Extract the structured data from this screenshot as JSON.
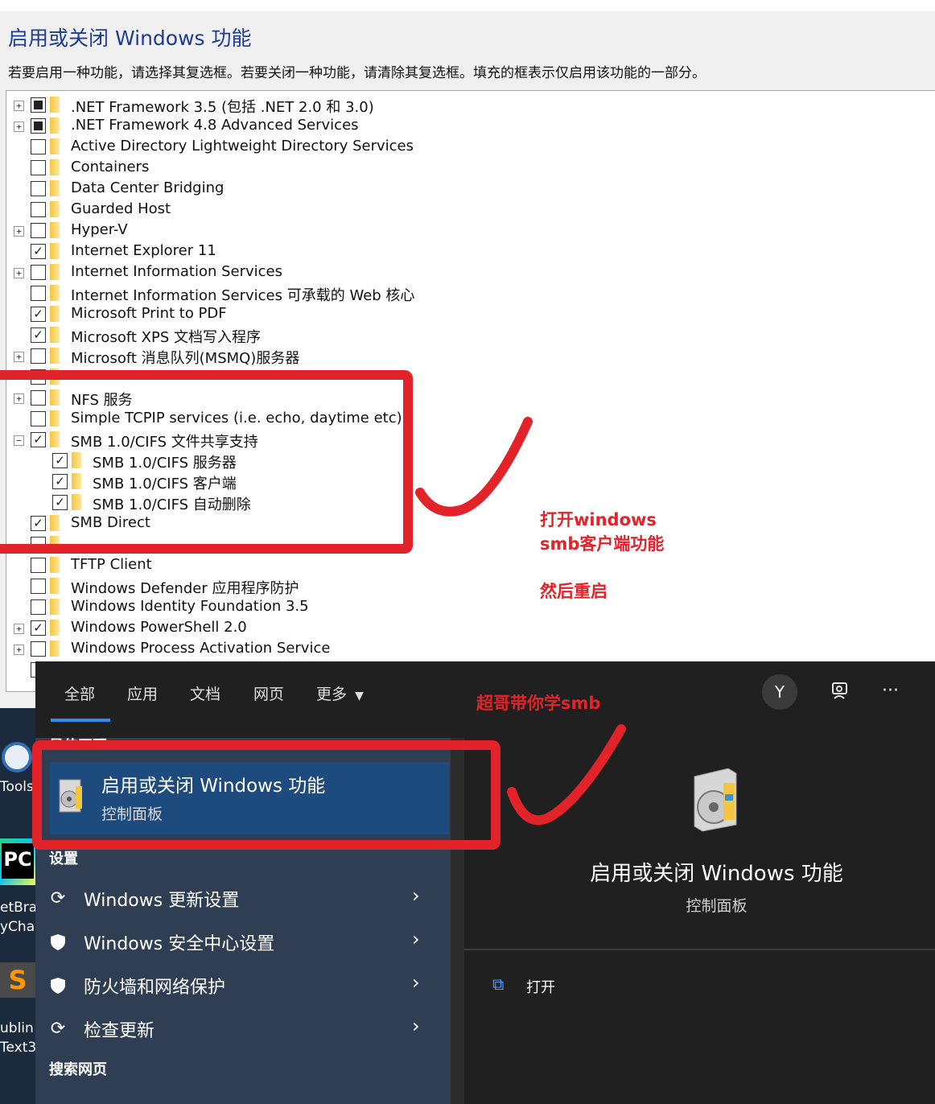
{
  "features_dialog": {
    "title": "启用或关闭 Windows 功能",
    "description": "若要启用一种功能，请选择其复选框。若要关闭一种功能，请清除其复选框。填充的框表示仅启用该功能的一部分。",
    "items": [
      {
        "label": ".NET Framework 3.5 (包括 .NET 2.0 和 3.0)",
        "state": "partial",
        "expander": "+",
        "indent": 0
      },
      {
        "label": ".NET Framework 4.8 Advanced Services",
        "state": "partial",
        "expander": "+",
        "indent": 0
      },
      {
        "label": "Active Directory Lightweight Directory Services",
        "state": "unchecked",
        "expander": "",
        "indent": 0
      },
      {
        "label": "Containers",
        "state": "unchecked",
        "expander": "",
        "indent": 0
      },
      {
        "label": "Data Center Bridging",
        "state": "unchecked",
        "expander": "",
        "indent": 0
      },
      {
        "label": "Guarded Host",
        "state": "unchecked",
        "expander": "",
        "indent": 0
      },
      {
        "label": "Hyper-V",
        "state": "unchecked",
        "expander": "+",
        "indent": 0
      },
      {
        "label": "Internet Explorer 11",
        "state": "checked",
        "expander": "",
        "indent": 0
      },
      {
        "label": "Internet Information Services",
        "state": "unchecked",
        "expander": "+",
        "indent": 0
      },
      {
        "label": "Internet Information Services 可承载的 Web 核心",
        "state": "unchecked",
        "expander": "",
        "indent": 0
      },
      {
        "label": "Microsoft Print to PDF",
        "state": "checked",
        "expander": "",
        "indent": 0
      },
      {
        "label": "Microsoft XPS 文档写入程序",
        "state": "checked",
        "expander": "",
        "indent": 0
      },
      {
        "label": "Microsoft 消息队列(MSMQ)服务器",
        "state": "unchecked",
        "expander": "+",
        "indent": 0
      },
      {
        "label": "",
        "state": "unchecked",
        "expander": "",
        "indent": 0
      },
      {
        "label": "NFS 服务",
        "state": "unchecked",
        "expander": "+",
        "indent": 0
      },
      {
        "label": "Simple TCPIP services (i.e. echo, daytime etc)",
        "state": "unchecked",
        "expander": "",
        "indent": 0
      },
      {
        "label": "SMB 1.0/CIFS 文件共享支持",
        "state": "checked",
        "expander": "−",
        "indent": 0
      },
      {
        "label": "SMB 1.0/CIFS 服务器",
        "state": "checked",
        "expander": "",
        "indent": 1
      },
      {
        "label": "SMB 1.0/CIFS 客户端",
        "state": "checked",
        "expander": "",
        "indent": 1
      },
      {
        "label": "SMB 1.0/CIFS 自动删除",
        "state": "checked",
        "expander": "",
        "indent": 1
      },
      {
        "label": "SMB Direct",
        "state": "checked",
        "expander": "",
        "indent": 0
      },
      {
        "label": "",
        "state": "unchecked",
        "expander": "",
        "indent": 0
      },
      {
        "label": "TFTP Client",
        "state": "unchecked",
        "expander": "",
        "indent": 0
      },
      {
        "label": "Windows Defender 应用程序防护",
        "state": "unchecked",
        "expander": "",
        "indent": 0
      },
      {
        "label": "Windows Identity Foundation 3.5",
        "state": "unchecked",
        "expander": "",
        "indent": 0
      },
      {
        "label": "Windows PowerShell 2.0",
        "state": "checked",
        "expander": "+",
        "indent": 0
      },
      {
        "label": "Windows Process Activation Service",
        "state": "unchecked",
        "expander": "+",
        "indent": 0
      },
      {
        "label": "",
        "state": "unchecked",
        "expander": "",
        "indent": 0
      }
    ]
  },
  "annotations": {
    "note_line1": "打开windows",
    "note_line2": "smb客户端功能",
    "note_line3": "然后重启",
    "search_note": "超哥带你学smb",
    "color": "#e3232a"
  },
  "desktop": {
    "icons": [
      {
        "label": "Tools",
        "icon": "camera-app-icon"
      },
      {
        "label": "etBrai",
        "icon": "pycharm-icon"
      },
      {
        "label": "yCha",
        "icon": ""
      },
      {
        "label": "ublin",
        "icon": "sublime-text-icon"
      },
      {
        "label": "Text3",
        "icon": ""
      }
    ]
  },
  "search_panel": {
    "tabs": [
      "全部",
      "应用",
      "文档",
      "网页",
      "更多"
    ],
    "active_tab": "全部",
    "avatar_letter": "Y",
    "best_match_heading": "最佳匹配",
    "best_match": {
      "title": "启用或关闭 Windows 功能",
      "subtitle": "控制面板"
    },
    "settings_heading": "设置",
    "settings": [
      {
        "label": "Windows 更新设置",
        "icon": "refresh-icon"
      },
      {
        "label": "Windows 安全中心设置",
        "icon": "shield-icon"
      },
      {
        "label": "防火墙和网络保护",
        "icon": "shield-icon"
      },
      {
        "label": "检查更新",
        "icon": "refresh-icon"
      }
    ],
    "web_heading": "搜索网页",
    "detail": {
      "title": "启用或关闭 Windows 功能",
      "subtitle": "控制面板",
      "action_open": "打开"
    },
    "accent": "#2a8ff0"
  }
}
